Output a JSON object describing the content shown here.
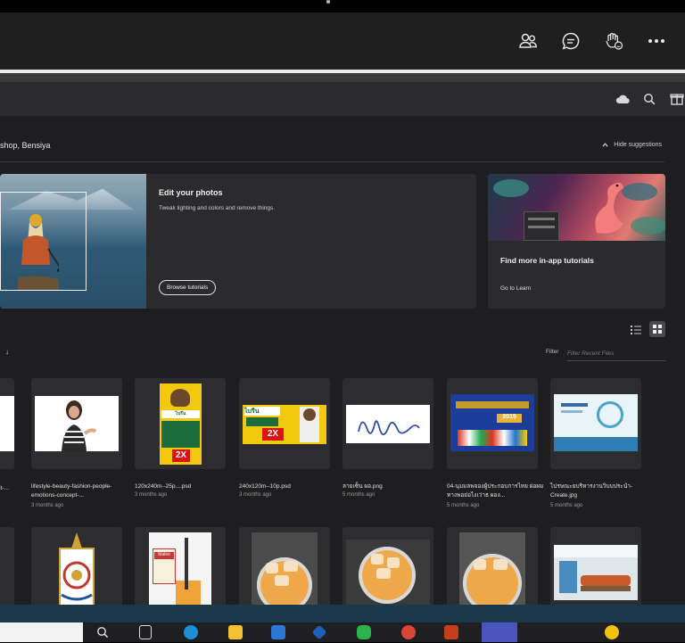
{
  "photoshop": {
    "greeting": "shop, Bensiya",
    "hide_suggestions": "Hide suggestions",
    "hero": {
      "title": "Edit your photos",
      "subtitle": "Tweak lighting and colors and remove things.",
      "button": "Browse tutorials"
    },
    "tutorial_card": {
      "title": "Find more in-app tutorials",
      "link": "Go to Learn"
    },
    "filter": {
      "label": "Filter",
      "placeholder": "Filter Recent Files"
    },
    "recent_files": [
      {
        "name": "lifestyle-beauty-fashion-people-emotions-concept-...",
        "date": "3 months ago"
      },
      {
        "name": "120x240m--25p....psd",
        "date": "3 months ago"
      },
      {
        "name": "240x120m--10p.psd",
        "date": "3 months ago"
      },
      {
        "name": "ลายเซ็น ผอ.png",
        "date": "5 months ago"
      },
      {
        "name": "04-นุมมลพจองผู้ประกอบการไทย ผ่อผมทางพอย่อไงเว่าธ ผอง...",
        "date": "5 months ago"
      },
      {
        "name": "ไปรษณะยบริหารงานวิบบประนำ-Create.jpg",
        "date": "5 months ago"
      }
    ],
    "left_partial_name": "it-..."
  },
  "colors": {
    "bg": "#1e1e20",
    "card": "#2b2b2e",
    "accent": "#3b6ea5"
  },
  "icons": [
    "people-icon",
    "chat-icon",
    "raise-hand-icon",
    "more-icon",
    "cloud-icon",
    "search-icon",
    "gift-icon",
    "list-view-icon",
    "grid-view-icon"
  ]
}
